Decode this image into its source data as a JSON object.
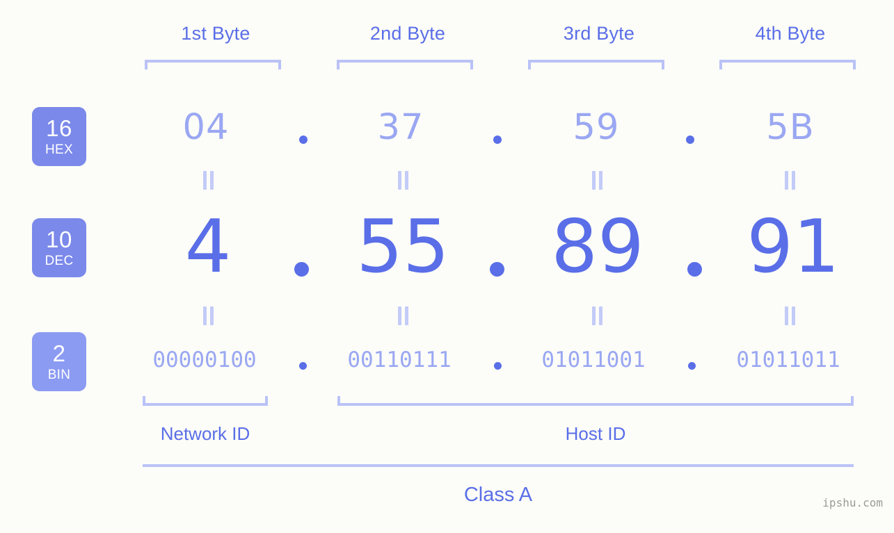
{
  "background_color": "#fcfdf8",
  "accent_strong": "#5a6ee8",
  "accent_light": "#9aa7f2",
  "accent_bracket": "#b9c2f7",
  "badge_color": "#7b89ea",
  "badge_color_bin": "#8b9bf2",
  "headers": {
    "bytes": [
      "1st Byte",
      "2nd Byte",
      "3rd Byte",
      "4th Byte"
    ]
  },
  "rows": {
    "hex": {
      "badge_num": "16",
      "badge_word": "HEX",
      "values": [
        "04",
        "37",
        "59",
        "5B"
      ],
      "separator": "."
    },
    "dec": {
      "badge_num": "10",
      "badge_word": "DEC",
      "values": [
        "4",
        "55",
        "89",
        "91"
      ],
      "separator": "."
    },
    "bin": {
      "badge_num": "2",
      "badge_word": "BIN",
      "values": [
        "00000100",
        "00110111",
        "01011001",
        "01011011"
      ],
      "separator": "."
    }
  },
  "equals_symbol": "=",
  "sections": {
    "network_id": "Network ID",
    "host_id": "Host ID",
    "class": "Class A"
  },
  "watermark": "ipshu.com"
}
